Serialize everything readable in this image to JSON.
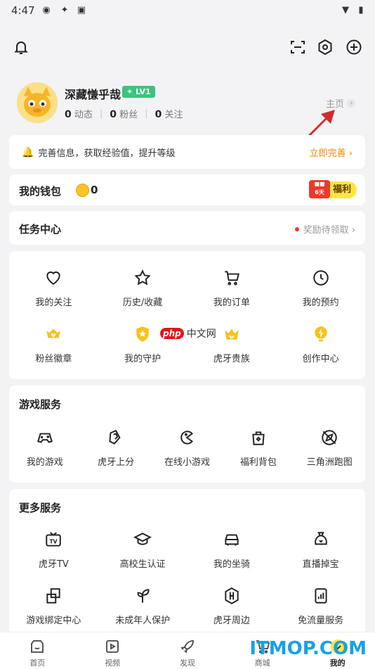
{
  "status_bar": {
    "time": "4:47"
  },
  "profile": {
    "name": "深藏慊乎哉",
    "level": "LV1",
    "stats": [
      {
        "count": "0",
        "label": "动态"
      },
      {
        "count": "0",
        "label": "粉丝"
      },
      {
        "count": "0",
        "label": "关注"
      }
    ],
    "home_link": "主页"
  },
  "banner": {
    "text": "完善信息，获取经验值，提升等级",
    "action": "立即完善 ›"
  },
  "wallet": {
    "title": "我的钱包",
    "amount": "0",
    "fuli": "福利",
    "fuli_tag": "6天"
  },
  "task_center": {
    "title": "任务中心",
    "status": "奖励待领取 ›"
  },
  "features": [
    {
      "label": "我的关注",
      "icon": "heart-icon"
    },
    {
      "label": "历史/收藏",
      "icon": "star-icon"
    },
    {
      "label": "我的订单",
      "icon": "cart-icon"
    },
    {
      "label": "我的预约",
      "icon": "clock-icon"
    },
    {
      "label": "粉丝徽章",
      "icon": "fan-badge-icon"
    },
    {
      "label": "我的守护",
      "icon": "guard-icon"
    },
    {
      "label": "虎牙贵族",
      "icon": "crown-icon"
    },
    {
      "label": "创作中心",
      "icon": "creator-icon"
    }
  ],
  "watermark": {
    "php": "php",
    "text": "中文网"
  },
  "game_services": {
    "title": "游戏服务",
    "items": [
      {
        "label": "我的游戏",
        "icon": "gamepad-icon"
      },
      {
        "label": "虎牙上分",
        "icon": "rank-icon"
      },
      {
        "label": "在线小游戏",
        "icon": "pacman-icon"
      },
      {
        "label": "福利背包",
        "icon": "bag-icon"
      },
      {
        "label": "三角洲跑图",
        "icon": "compass-icon"
      }
    ]
  },
  "more_services": {
    "title": "更多服务",
    "items": [
      {
        "label": "虎牙TV",
        "icon": "tv-icon"
      },
      {
        "label": "高校生认证",
        "icon": "graduation-icon"
      },
      {
        "label": "我的坐骑",
        "icon": "car-icon"
      },
      {
        "label": "直播掉宝",
        "icon": "treasure-bag-icon"
      },
      {
        "label": "游戏绑定中心",
        "icon": "bind-icon"
      },
      {
        "label": "未成年人保护",
        "icon": "sprout-icon"
      },
      {
        "label": "虎牙周边",
        "icon": "huya-goods-icon"
      },
      {
        "label": "免流量服务",
        "icon": "data-icon"
      }
    ]
  },
  "tabs": [
    {
      "label": "首页",
      "icon": "home-tab-icon"
    },
    {
      "label": "视频",
      "icon": "video-tab-icon"
    },
    {
      "label": "发现",
      "icon": "rocket-tab-icon"
    },
    {
      "label": "商城",
      "icon": "mall-tab-icon"
    },
    {
      "label": "我的",
      "icon": "me-tab-icon",
      "active": true
    }
  ],
  "site_watermark": "ITMOP.COM",
  "colors": {
    "accent": "#fde63f",
    "level_badge": "#3cc47f",
    "action": "#f08a00"
  }
}
